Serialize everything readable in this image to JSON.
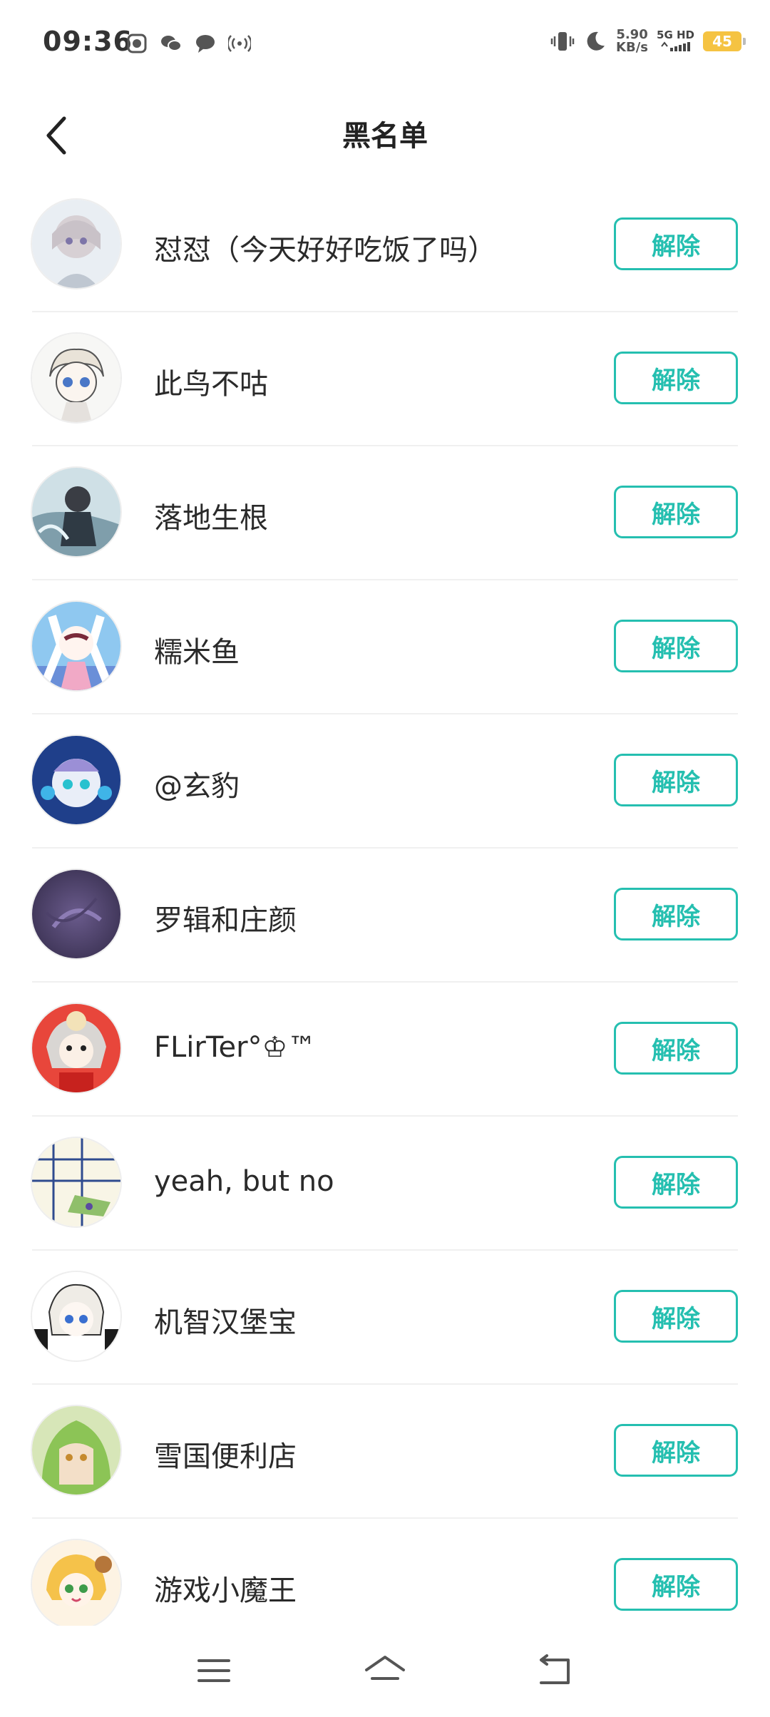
{
  "status_bar": {
    "time": "09:36",
    "net_speed_value": "5.90",
    "net_speed_unit": "KB/s",
    "net_type_top": "5G HD",
    "battery": "45",
    "icons": [
      "gallery-icon",
      "wechat-icon",
      "message-icon",
      "hotspot-icon",
      "vibrate-icon",
      "moon-icon",
      "signal-icon"
    ]
  },
  "header": {
    "title": "黑名单",
    "back_icon": "chevron-left-icon"
  },
  "list": {
    "button_label": "解除",
    "accent_color": "#25bfb0",
    "items": [
      {
        "name": "怼怼（今天好好吃饭了吗）"
      },
      {
        "name": "此鸟不咕"
      },
      {
        "name": "落地生根"
      },
      {
        "name": "糯米鱼"
      },
      {
        "name": "@玄豹"
      },
      {
        "name": "罗辑和庄颜"
      },
      {
        "name": "FLirTer°♔™"
      },
      {
        "name": "yeah, but no"
      },
      {
        "name": "机智汉堡宝"
      },
      {
        "name": "雪国便利店"
      },
      {
        "name": "游戏小魔王"
      }
    ]
  },
  "nav_bar": {
    "icons": [
      "menu-icon",
      "home-icon",
      "back-icon"
    ]
  }
}
